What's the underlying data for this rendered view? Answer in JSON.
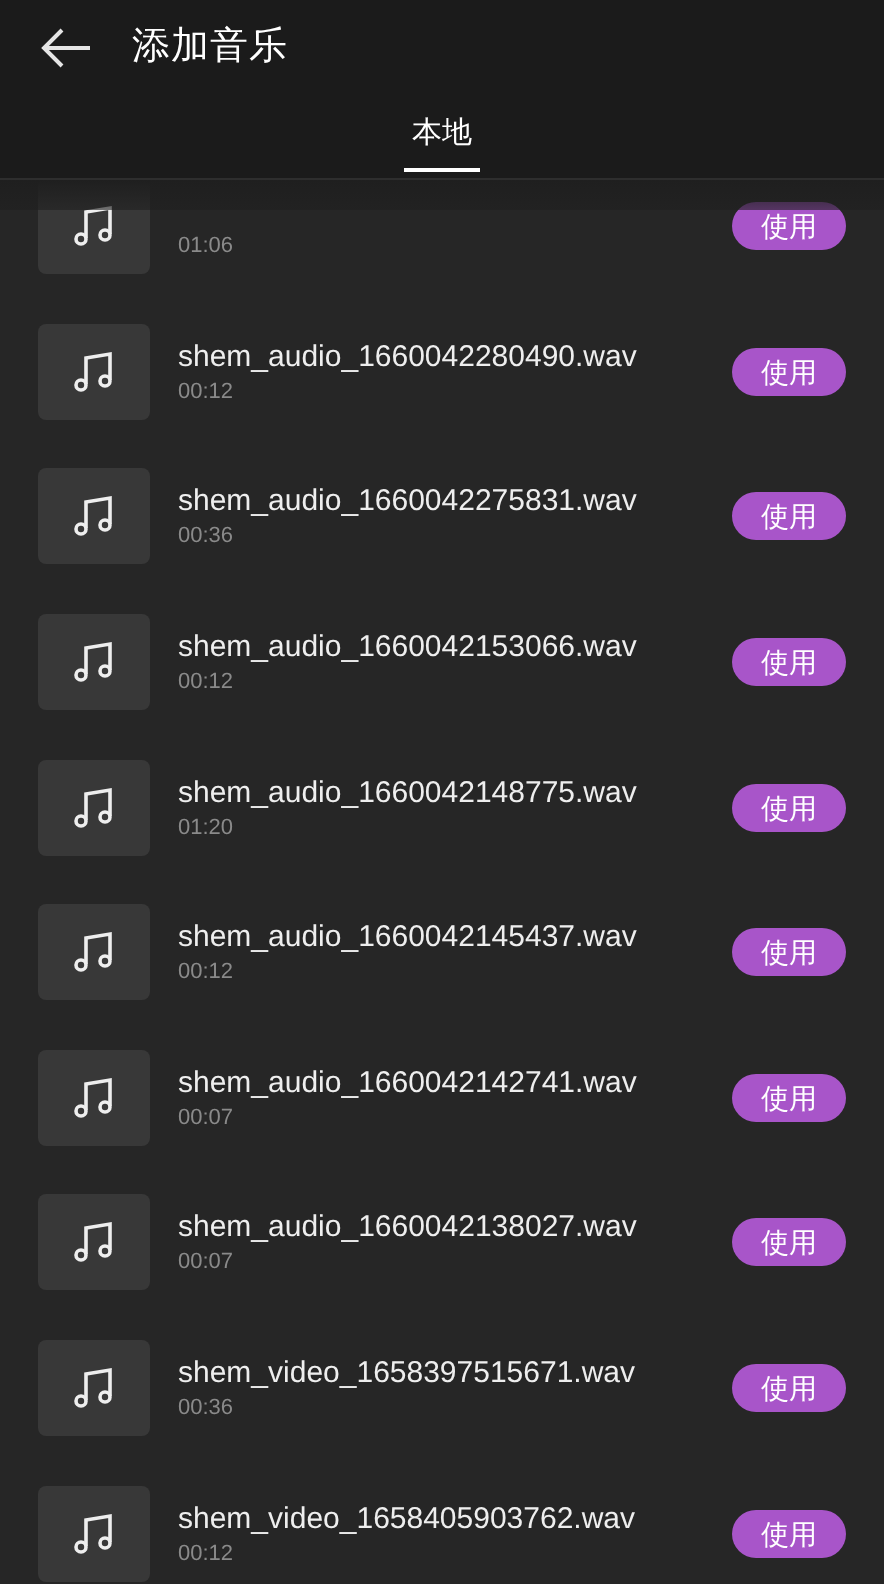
{
  "header": {
    "title": "添加音乐"
  },
  "tabs": [
    {
      "label": "本地",
      "selected": true
    }
  ],
  "tracks": [
    {
      "duration": "01:06",
      "button": "使用"
    },
    {
      "name": "shem_audio_1660042280490.wav",
      "duration": "00:12",
      "button": "使用"
    },
    {
      "name": "shem_audio_1660042275831.wav",
      "duration": "00:36",
      "button": "使用"
    },
    {
      "name": "shem_audio_1660042153066.wav",
      "duration": "00:12",
      "button": "使用"
    },
    {
      "name": "shem_audio_1660042148775.wav",
      "duration": "01:20",
      "button": "使用"
    },
    {
      "name": "shem_audio_1660042145437.wav",
      "duration": "00:12",
      "button": "使用"
    },
    {
      "name": "shem_audio_1660042142741.wav",
      "duration": "00:07",
      "button": "使用"
    },
    {
      "name": "shem_audio_1660042138027.wav",
      "duration": "00:07",
      "button": "使用"
    },
    {
      "name": "shem_video_1658397515671.wav",
      "duration": "00:36",
      "button": "使用"
    },
    {
      "name": "shem_video_1658405903762.wav",
      "duration": "00:12",
      "button": "使用"
    }
  ]
}
